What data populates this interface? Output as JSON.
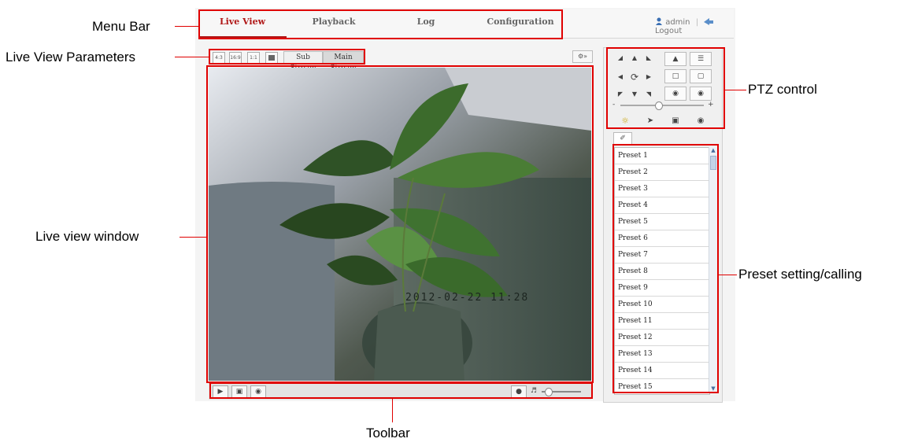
{
  "callouts": {
    "menu_bar": "Menu Bar",
    "live_view_parameters": "Live View Parameters",
    "live_view_window": "Live view window",
    "toolbar": "Toolbar",
    "ptz_control": "PTZ control",
    "preset_setting": "Preset setting/calling"
  },
  "menu": {
    "tabs": [
      "Live View",
      "Playback",
      "Log",
      "Configuration"
    ],
    "active_tab": "Live View",
    "user": "admin",
    "separator": "|",
    "logout": "Logout"
  },
  "params": {
    "ratio_buttons": [
      "4:3",
      "16:9",
      "1:1",
      "fit"
    ],
    "sub_stream": "Sub Stream",
    "main_stream": "Main Stream",
    "ptz_toggle_icon": "ptz-toggle-icon"
  },
  "video": {
    "overlay_timestamp": "2012-02-22 11:28"
  },
  "toolbar": {
    "icons": [
      "play-icon",
      "snapshot-icon",
      "record-icon",
      "microphone-icon",
      "volume-icon"
    ],
    "volume_level": 0.1
  },
  "ptz": {
    "direction_icons": [
      "up-left-arrow",
      "up-arrow",
      "up-right-arrow",
      "left-arrow",
      "auto-rotate",
      "right-arrow",
      "down-left-arrow",
      "down-arrow",
      "down-right-arrow"
    ],
    "zoom_minus": "-",
    "zoom_plus": "+",
    "speed_level": 0.45
  },
  "presets": {
    "items": [
      "Preset 1",
      "Preset 2",
      "Preset 3",
      "Preset 4",
      "Preset 5",
      "Preset 6",
      "Preset 7",
      "Preset 8",
      "Preset 9",
      "Preset 10",
      "Preset 11",
      "Preset 12",
      "Preset 13",
      "Preset 14",
      "Preset 15"
    ]
  },
  "colors": {
    "annotation_red": "#e00000",
    "active_tab": "#b01818"
  }
}
